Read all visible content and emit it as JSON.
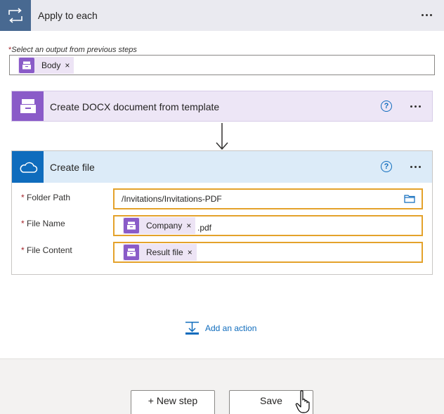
{
  "loop": {
    "title": "Apply to each",
    "icon": "loop-icon"
  },
  "select_output": {
    "required_mark": "*",
    "label": "Select an output from previous steps",
    "token": {
      "label": "Body",
      "remove": "×",
      "icon": "template-icon"
    }
  },
  "docx_action": {
    "title": "Create DOCX document from template",
    "help": "?",
    "icon": "template-icon",
    "color": "#8a5bc8"
  },
  "create_file": {
    "title": "Create file",
    "help": "?",
    "icon": "onedrive-cloud-icon",
    "color": "#0f6cbd",
    "fields": {
      "folder_path": {
        "required_mark": "*",
        "label": "Folder Path",
        "value": "/Invitations/Invitations-PDF"
      },
      "file_name": {
        "required_mark": "*",
        "label": "File Name",
        "token": {
          "label": "Company",
          "remove": "×"
        },
        "suffix": ".pdf"
      },
      "file_content": {
        "required_mark": "*",
        "label": "File Content",
        "token": {
          "label": "Result file",
          "remove": "×"
        }
      }
    }
  },
  "add_action": {
    "label": "Add an action"
  },
  "footer": {
    "new_step": "+ New step",
    "save": "Save"
  },
  "colors": {
    "highlight_border": "#e4a22b",
    "link": "#0f6cbd",
    "loop_header": "#486991"
  }
}
